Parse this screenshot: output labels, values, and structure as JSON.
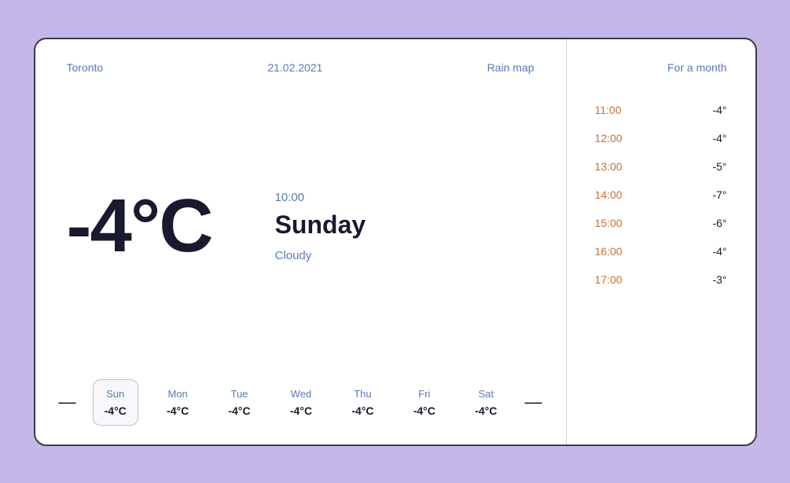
{
  "header": {
    "city": "Toronto",
    "date": "21.02.2021",
    "rain_map": "Rain map",
    "for_a_month": "For a month"
  },
  "main": {
    "temperature": "-4°C",
    "time": "10:00",
    "day": "Sunday",
    "condition": "Cloudy"
  },
  "forecast": [
    {
      "day": "Sun",
      "temp": "-4°C",
      "active": true
    },
    {
      "day": "Mon",
      "temp": "-4°C",
      "active": false
    },
    {
      "day": "Tue",
      "temp": "-4°C",
      "active": false
    },
    {
      "day": "Wed",
      "temp": "-4°C",
      "active": false
    },
    {
      "day": "Thu",
      "temp": "-4°C",
      "active": false
    },
    {
      "day": "Fri",
      "temp": "-4°C",
      "active": false
    },
    {
      "day": "Sat",
      "temp": "-4°C",
      "active": false
    }
  ],
  "hourly": [
    {
      "time": "11:00",
      "temp": "-4°"
    },
    {
      "time": "12:00",
      "temp": "-4°"
    },
    {
      "time": "13:00",
      "temp": "-5°"
    },
    {
      "time": "14:00",
      "temp": "-7°"
    },
    {
      "time": "15:00",
      "temp": "-6°"
    },
    {
      "time": "16:00",
      "temp": "-4°"
    },
    {
      "time": "17:00",
      "temp": "-3°"
    }
  ],
  "arrows": {
    "left": "—",
    "right": "—"
  }
}
